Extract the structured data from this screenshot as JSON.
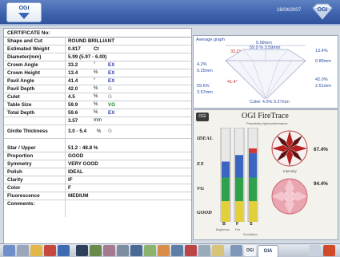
{
  "header": {
    "logo_left_text": "OGI",
    "logo_right_text": "OGI",
    "date": "16/04/2007"
  },
  "certificate": {
    "title": "CERTIFICATE No:",
    "rows": {
      "shape": {
        "label": "Shape and Cut",
        "value": "ROUND BRILLIANT"
      },
      "weight": {
        "label": "Estimated Weight",
        "value": "0.817",
        "unit": "Ct"
      },
      "diameter": {
        "label": "Diameter(mm)",
        "value": "5.99 (5.97 - 6.00)"
      },
      "crown_angle": {
        "label": "Crown Angle",
        "value": "33.2",
        "unit": "°",
        "grade": "EX"
      },
      "crown_height": {
        "label": "Crown Height",
        "value": "13.4",
        "unit": "%",
        "grade": "EX"
      },
      "pavil_angle": {
        "label": "Pavil Angle",
        "value": "41.4",
        "unit": "°",
        "grade": "EX"
      },
      "pavil_depth": {
        "label": "Pavil Depth",
        "value": "42.0",
        "unit": "%",
        "grade": "G"
      },
      "culet": {
        "label": "Culet",
        "value": "4.5",
        "unit": "%",
        "grade": "G"
      },
      "table": {
        "label": "Table Size",
        "value": "59.9",
        "unit": "%",
        "grade": "VG"
      },
      "total_depth": {
        "label": "Total Depth",
        "value": "59.6",
        "unit": "%",
        "grade": "EX"
      },
      "total_depth_mm": {
        "value": "3.57",
        "unit": "mm"
      },
      "girdle": {
        "label": "Girdle Thickness",
        "value": "3.0 - 5.4",
        "unit": "%",
        "grade": "G"
      },
      "star": {
        "label": "Star / Upper",
        "value": "51.2 : 48.8 %"
      },
      "proportion": {
        "label": "Proportion",
        "value": "GOOD"
      },
      "symmetry": {
        "label": "Symmetry",
        "value": "VERY GOOD"
      },
      "polish": {
        "label": "Polish",
        "value": "IDEAL"
      },
      "clarity": {
        "label": "Clarity",
        "value": "IF"
      },
      "color": {
        "label": "Color",
        "value": "F"
      },
      "fluorescence": {
        "label": "Fluorescence",
        "value": "MEDIUM"
      },
      "comments": {
        "label": "Comments:"
      }
    }
  },
  "average_graph": {
    "title": "Average graph",
    "top_mm": "5.99mm",
    "table_pct_mm": "59.9 % 3.59mm",
    "crown_angle": "33.2°",
    "crown_height_pct": "13.4%",
    "crown_height_mm": "0.80mm",
    "left_pct": "4.2%",
    "left_mm": "0.25mm",
    "pavil_angle": "41.4°",
    "depth_pct": "59.6%",
    "depth_mm": "3.57mm",
    "pavil_depth_pct": "42.0%",
    "pavil_depth_mm": "2.51mm",
    "culet": "Culet: 4.5% 0.27mm"
  },
  "fire_trace": {
    "brand": "OGI",
    "title": "FireTrace",
    "subtitle": "Proprietary light performance",
    "ogi_badge": "OGI",
    "levels": [
      "IDEAL",
      "EX",
      "VG",
      "GOOD"
    ],
    "bars": [
      {
        "letter": "B",
        "label": "Brightness",
        "value": 0.64
      },
      {
        "letter": "F",
        "label": "Fire",
        "value": 0.71
      },
      {
        "letter": "S",
        "label": "Scintillation",
        "value": 0.78
      }
    ],
    "intensity_label": "Intensity",
    "pct1": "67.4%",
    "pct2": "94.4%"
  },
  "toolbar": {
    "gia_label": "GIA",
    "ogi_label": "OGI"
  },
  "colors": {
    "header": "#3f64ad",
    "grade_ex": "#2b3ca8",
    "grade_vg": "#1f8a2a"
  }
}
